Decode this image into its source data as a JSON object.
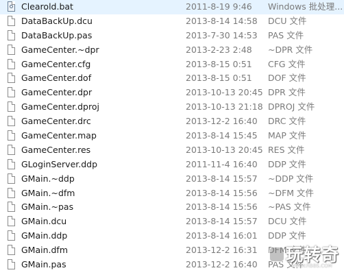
{
  "files": [
    {
      "name": "Clearold.bat",
      "date": "2011-8-19 9:46",
      "type": "Windows 批处理...",
      "icon": "batch-file-icon"
    },
    {
      "name": "DataBackUp.dcu",
      "date": "2013-8-14 14:58",
      "type": "DCU 文件",
      "icon": "file-icon"
    },
    {
      "name": "DataBackUp.pas",
      "date": "2013-7-30 14:53",
      "type": "PAS 文件",
      "icon": "file-icon"
    },
    {
      "name": "GameCenter.~dpr",
      "date": "2013-2-23 2:48",
      "type": "~DPR 文件",
      "icon": "file-icon"
    },
    {
      "name": "GameCenter.cfg",
      "date": "2013-8-15 0:51",
      "type": "CFG 文件",
      "icon": "file-icon"
    },
    {
      "name": "GameCenter.dof",
      "date": "2013-8-15 0:51",
      "type": "DOF 文件",
      "icon": "file-icon"
    },
    {
      "name": "GameCenter.dpr",
      "date": "2013-10-13 20:45",
      "type": "DPR 文件",
      "icon": "file-icon"
    },
    {
      "name": "GameCenter.dproj",
      "date": "2013-10-13 21:18",
      "type": "DPROJ 文件",
      "icon": "file-icon"
    },
    {
      "name": "GameCenter.drc",
      "date": "2013-12-2 16:40",
      "type": "DRC 文件",
      "icon": "file-icon"
    },
    {
      "name": "GameCenter.map",
      "date": "2013-8-14 15:45",
      "type": "MAP 文件",
      "icon": "file-icon"
    },
    {
      "name": "GameCenter.res",
      "date": "2013-10-13 20:45",
      "type": "RES 文件",
      "icon": "file-icon"
    },
    {
      "name": "GLoginServer.ddp",
      "date": "2011-11-4 16:40",
      "type": "DDP 文件",
      "icon": "file-icon"
    },
    {
      "name": "GMain.~ddp",
      "date": "2013-8-14 15:57",
      "type": "~DDP 文件",
      "icon": "file-icon"
    },
    {
      "name": "GMain.~dfm",
      "date": "2013-8-14 15:56",
      "type": "~DFM 文件",
      "icon": "file-icon"
    },
    {
      "name": "GMain.~pas",
      "date": "2013-8-14 15:56",
      "type": "~PAS 文件",
      "icon": "file-icon"
    },
    {
      "name": "GMain.dcu",
      "date": "2013-8-14 15:57",
      "type": "DCU 文件",
      "icon": "file-icon"
    },
    {
      "name": "GMain.ddp",
      "date": "2013-8-14 16:01",
      "type": "DDP 文件",
      "icon": "file-icon"
    },
    {
      "name": "GMain.dfm",
      "date": "2013-12-2 16:31",
      "type": "DFM 文件",
      "icon": "file-icon"
    },
    {
      "name": "GMain.pas",
      "date": "2013-12-2 16:40",
      "type": "PAS 文件",
      "icon": "file-icon"
    }
  ],
  "watermark": {
    "main": "玩转奇",
    "sub": "WWW.RBBS.COM"
  }
}
